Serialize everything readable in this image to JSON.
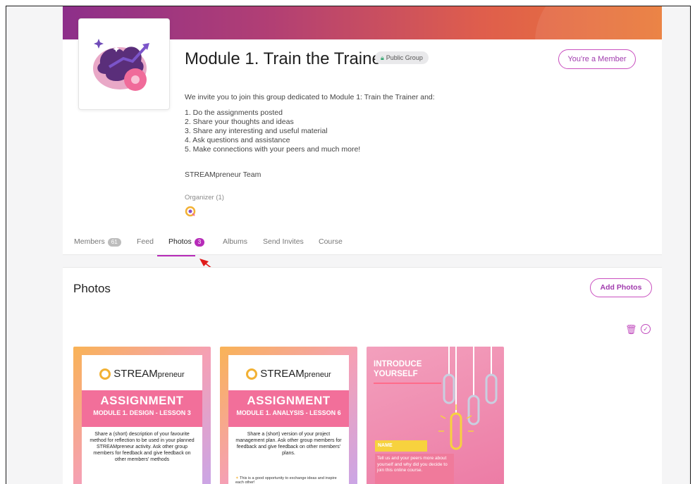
{
  "group": {
    "title": "Module 1. Train the Trainer",
    "privacy_badge": "Public Group",
    "membership_button": "You're a Member",
    "description_intro": "We invite you to join this group dedicated to Module 1: Train the Trainer and:",
    "description_items": [
      "1. Do the assignments posted",
      "2. Share your thoughts and ideas",
      "3. Share any interesting and useful material",
      "4. Ask questions and assistance",
      "5. Make connections with your peers and much more!"
    ],
    "signature": "STREAMpreneur Team",
    "organizer_label": "Organizer (1)"
  },
  "tabs": [
    {
      "label": "Members",
      "count": "61"
    },
    {
      "label": "Feed"
    },
    {
      "label": "Photos",
      "count": "3"
    },
    {
      "label": "Albums"
    },
    {
      "label": "Send Invites"
    },
    {
      "label": "Course"
    }
  ],
  "photos": {
    "title": "Photos",
    "add_button": "Add Photos",
    "items": [
      {
        "logo": "STREAM",
        "logo_suffix": "preneur",
        "heading": "ASSIGNMENT",
        "subheading": "MODULE 1. DESIGN - LESSON 3",
        "body": "Share a (short) description of your favourite method for reflection to be used in your planned STREAMpreneur activity. Ask other group members for feedback and give feedback on other members' methods"
      },
      {
        "logo": "STREAM",
        "logo_suffix": "preneur",
        "heading": "ASSIGNMENT",
        "subheading": "MODULE 1. ANALYSIS - LESSON 6",
        "body": "Share a (short) version of your project management plan. Ask other group members for feedback and give feedback on other members' plans.",
        "footer": "This is a good opportunity to exchange ideas and inspire each other!"
      },
      {
        "heading_line1": "INTRODUCE",
        "heading_line2": "YOURSELF",
        "name_label": "NAME",
        "body": "Tell us and your peers more about yourself and why did you decide to join this online course."
      }
    ]
  },
  "colors": {
    "accent": "#b62bb8",
    "banner_start": "#8d2f8a",
    "banner_end": "#ea7a37"
  }
}
